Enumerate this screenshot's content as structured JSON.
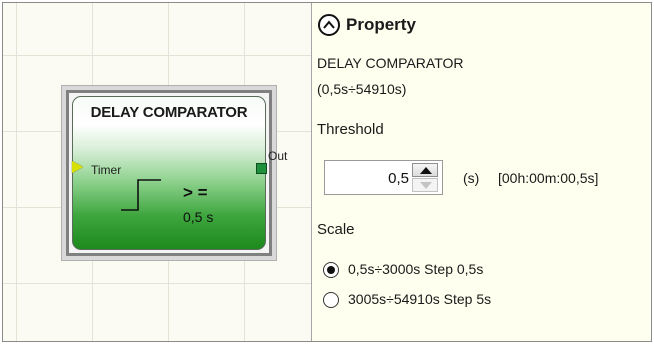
{
  "canvas": {
    "block": {
      "title": "DELAY COMPARATOR",
      "input_label": "Timer",
      "output_label": "Out",
      "operator": "> =",
      "value_text": "0,5 s"
    }
  },
  "property": {
    "title": "Property",
    "component_name": "DELAY COMPARATOR",
    "component_range": "(0,5s÷54910s)",
    "threshold": {
      "label": "Threshold",
      "value": "0,5",
      "unit": "(s)",
      "formatted_time": "[00h:00m:00,5s]"
    },
    "scale": {
      "label": "Scale",
      "options": [
        {
          "label": "0,5s÷3000s Step 0,5s",
          "selected": true
        },
        {
          "label": "3005s÷54910s Step 5s",
          "selected": false
        }
      ]
    }
  },
  "colors": {
    "block_gradient_bottom": "#1c8a1c",
    "input_pin": "#d8e000",
    "output_pin": "#1e8f3a",
    "panel_background": "#fffff0"
  },
  "icons": {
    "collapse": "chevron-up-circle-icon",
    "spin_up": "triangle-up-icon",
    "spin_down": "triangle-down-icon",
    "step_function": "step-function-icon"
  }
}
